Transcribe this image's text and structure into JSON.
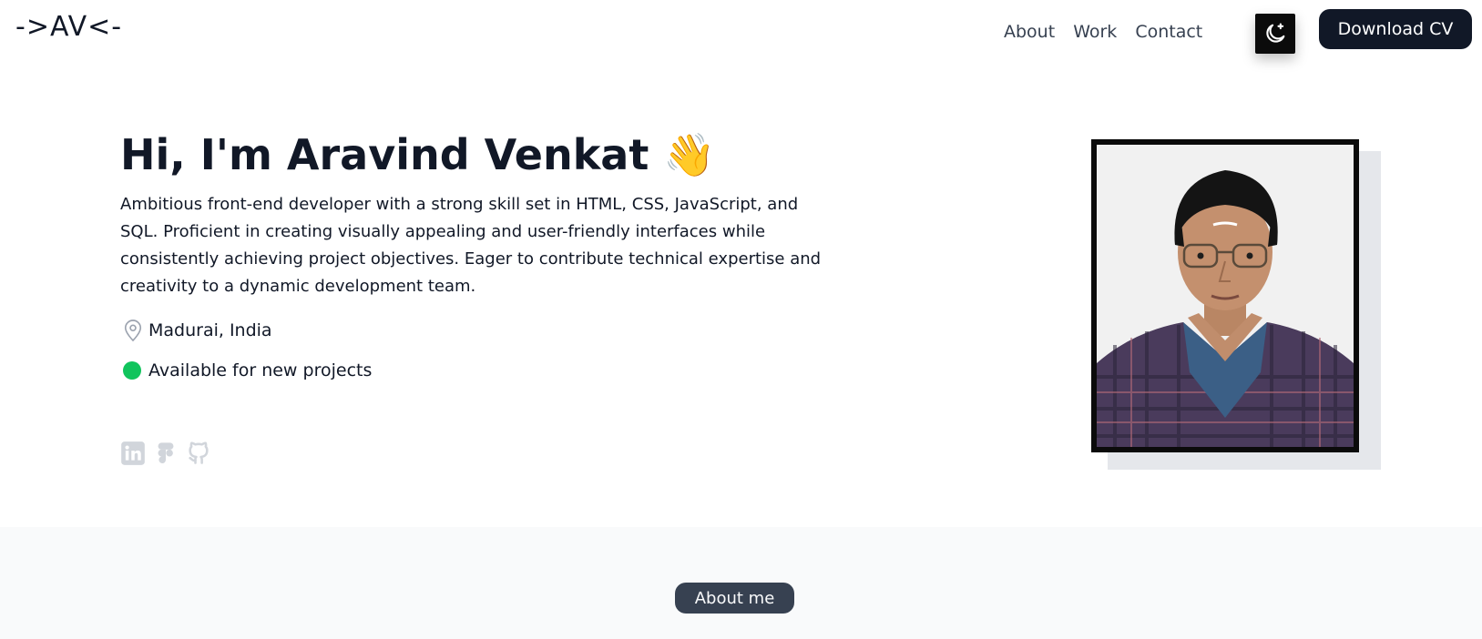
{
  "nav": {
    "logo": "->AV<-",
    "links": [
      "About",
      "Work",
      "Contact"
    ],
    "theme_toggle_icon": "moon-sparkle-icon",
    "download_cv_label": "Download CV"
  },
  "hero": {
    "title": "Hi, I'm Aravind Venkat",
    "wave_emoji": "👋",
    "bio": "Ambitious front-end developer with a strong skill set in HTML, CSS, JavaScript, and SQL. Proficient in creating visually appealing and user-friendly interfaces while consistently achieving project objectives. Eager to contribute technical expertise and creativity to a dynamic development team.",
    "location": "Madurai, India",
    "availability": "Available for new projects",
    "socials": [
      "linkedin-icon",
      "figma-icon",
      "github-icon"
    ]
  },
  "about_section": {
    "pill_label": "About me"
  },
  "colors": {
    "primary": "#111827",
    "status_green": "#10c45c",
    "section_bg": "#f9fafb"
  }
}
